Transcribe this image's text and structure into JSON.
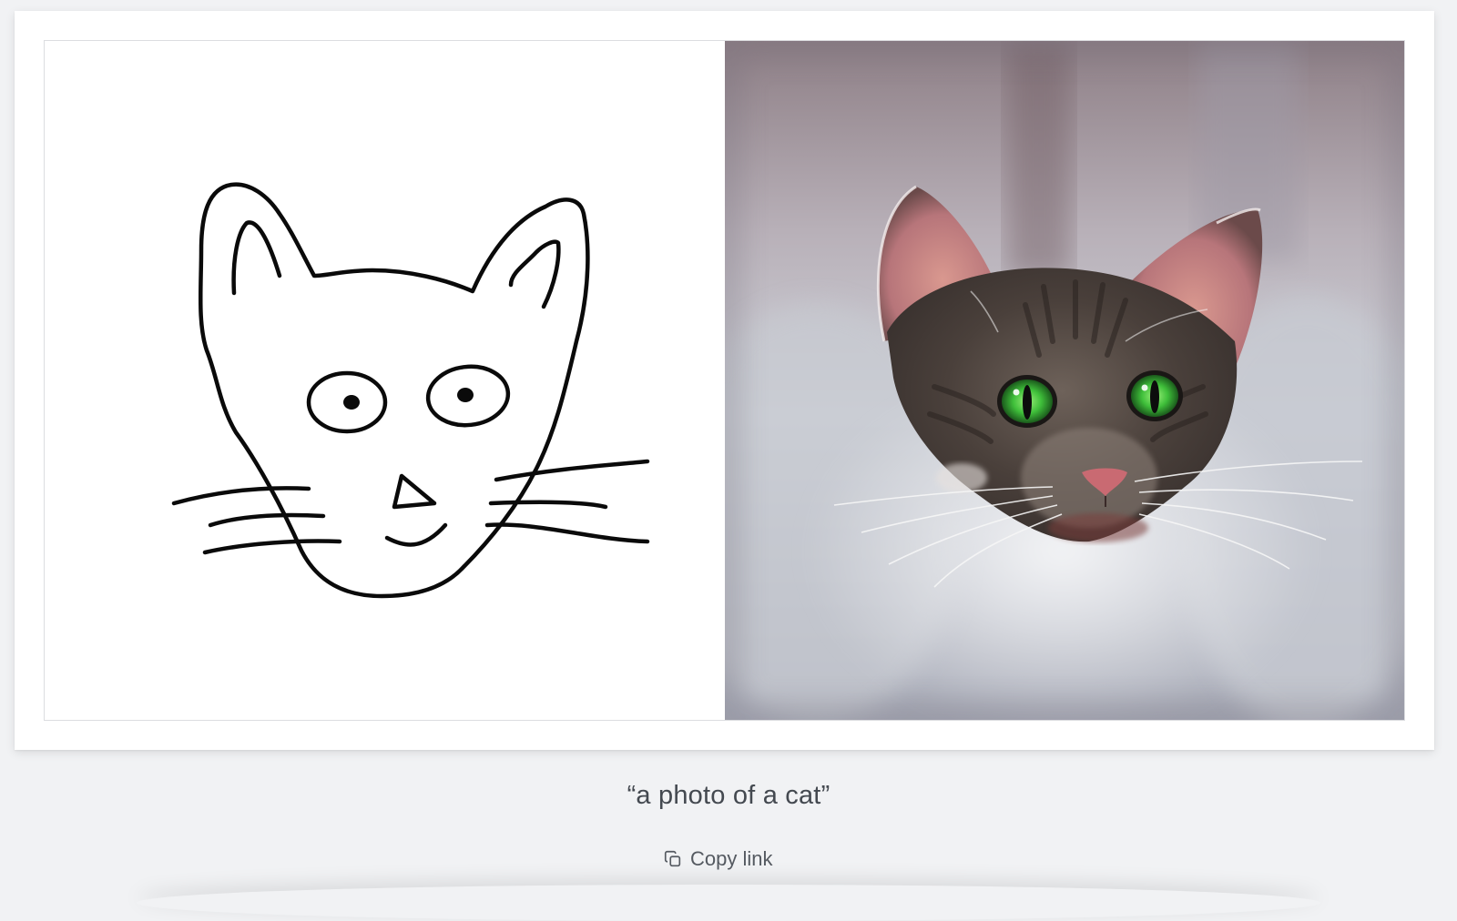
{
  "caption": "“a photo of a cat”",
  "copy_link": {
    "label": "Copy link",
    "icon": "copy-icon"
  },
  "images": {
    "input": {
      "icon": "cat-sketch-drawing"
    },
    "output": {
      "icon": "cat-photo"
    }
  },
  "colors": {
    "page_background": "#f1f2f4",
    "card_background": "#ffffff",
    "caption_text": "#444950",
    "cat_eye_green": "#3fbf3a"
  }
}
